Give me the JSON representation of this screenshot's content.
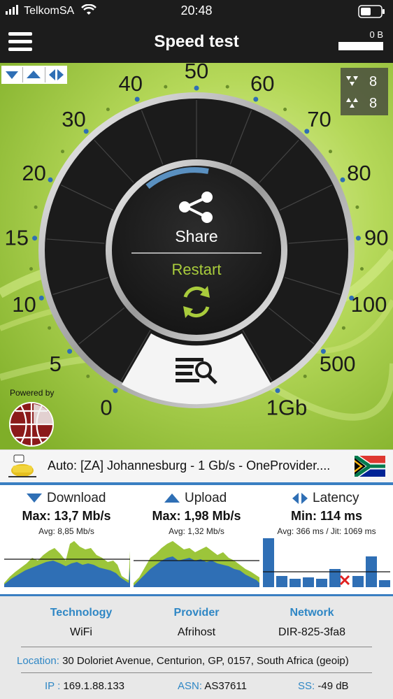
{
  "status": {
    "carrier": "TelkomSA",
    "time": "20:48"
  },
  "header": {
    "title": "Speed test",
    "bytes": "0 B"
  },
  "dial": {
    "scale": [
      "0",
      "5",
      "10",
      "15",
      "20",
      "30",
      "40",
      "50",
      "60",
      "70",
      "80",
      "90",
      "100",
      "500",
      "1Gb"
    ],
    "share_label": "Share",
    "restart_label": "Restart"
  },
  "counters": {
    "first": "8",
    "second": "8"
  },
  "powered_by": "Powered by",
  "server": {
    "text": "Auto: [ZA] Johannesburg - 1 Gb/s - OneProvider...."
  },
  "metrics": {
    "download": {
      "label": "Download",
      "max": "Max: 13,7 Mb/s",
      "avg": "Avg: 8,85 Mb/s"
    },
    "upload": {
      "label": "Upload",
      "max": "Max: 1,98 Mb/s",
      "avg": "Avg: 1,32 Mb/s"
    },
    "latency": {
      "label": "Latency",
      "min": "Min: 114 ms",
      "avg": "Avg: 366 ms / Jit: 1069 ms"
    }
  },
  "info": {
    "technology": {
      "label": "Technology",
      "value": "WiFi"
    },
    "provider": {
      "label": "Provider",
      "value": "Afrihost"
    },
    "network": {
      "label": "Network",
      "value": "DIR-825-3fa8"
    },
    "location": {
      "label": "Location:",
      "value": "30 Doloriet Avenue, Centurion, GP, 0157, South Africa (geoip)"
    },
    "ip": {
      "label": "IP :",
      "value": "169.1.88.133"
    },
    "asn": {
      "label": "ASN:",
      "value": "AS37611"
    },
    "ss": {
      "label": "SS:",
      "value": "-49 dB"
    }
  },
  "colors": {
    "dark": "#1c1c1c",
    "green": "#9cc53a",
    "blue": "#2f87c5",
    "red": "#e02020"
  }
}
